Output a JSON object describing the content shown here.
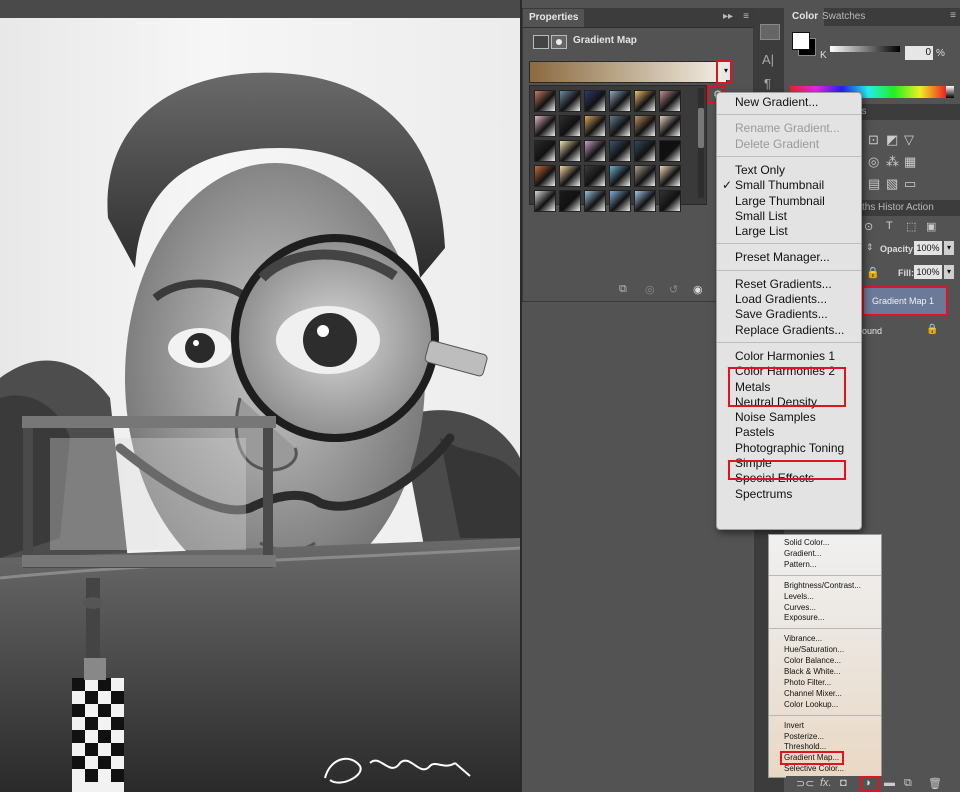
{
  "properties_panel": {
    "tab_label": "Properties",
    "adjustment_title": "Gradient Map"
  },
  "gradient_menu": {
    "groups": [
      [
        {
          "label": "New Gradient...",
          "enabled": true
        }
      ],
      [
        {
          "label": "Rename Gradient...",
          "enabled": false
        },
        {
          "label": "Delete Gradient",
          "enabled": false
        }
      ],
      [
        {
          "label": "Text Only",
          "enabled": true
        },
        {
          "label": "Small Thumbnail",
          "enabled": true,
          "checked": true
        },
        {
          "label": "Large Thumbnail",
          "enabled": true
        },
        {
          "label": "Small List",
          "enabled": true
        },
        {
          "label": "Large List",
          "enabled": true
        }
      ],
      [
        {
          "label": "Preset Manager...",
          "enabled": true
        }
      ],
      [
        {
          "label": "Reset Gradients...",
          "enabled": true
        },
        {
          "label": "Load Gradients...",
          "enabled": true
        },
        {
          "label": "Save Gradients...",
          "enabled": true
        },
        {
          "label": "Replace Gradients...",
          "enabled": true
        }
      ],
      [
        {
          "label": "Color Harmonies 1",
          "enabled": true,
          "highlighted": true
        },
        {
          "label": "Color Harmonies 2",
          "enabled": true,
          "highlighted": true
        },
        {
          "label": "Metals",
          "enabled": true
        },
        {
          "label": "Neutral Density",
          "enabled": true
        },
        {
          "label": "Noise Samples",
          "enabled": true
        },
        {
          "label": "Pastels",
          "enabled": true
        },
        {
          "label": "Photographic Toning",
          "enabled": true,
          "highlighted": true
        },
        {
          "label": "Simple",
          "enabled": true
        },
        {
          "label": "Special Effects",
          "enabled": true
        },
        {
          "label": "Spectrums",
          "enabled": true
        }
      ]
    ]
  },
  "color_panel": {
    "tabs": [
      "Color",
      "Swatches"
    ],
    "channel_label": "K",
    "value": "0",
    "unit": "%"
  },
  "layers_panel": {
    "tabs_partial": [
      "ths",
      "Histor",
      "Action"
    ],
    "opacity_label": "Opacity:",
    "opacity_value": "100%",
    "fill_label": "Fill:",
    "fill_value": "100%",
    "layers": [
      {
        "name": "Gradient Map 1",
        "selected": true
      },
      {
        "name": "ound",
        "selected": false,
        "locked": true
      }
    ]
  },
  "adjustment_menu": {
    "groups": [
      [
        "Solid Color...",
        "Gradient...",
        "Pattern..."
      ],
      [
        "Brightness/Contrast...",
        "Levels...",
        "Curves...",
        "Exposure..."
      ],
      [
        "Vibrance...",
        "Hue/Saturation...",
        "Color Balance...",
        "Black & White...",
        "Photo Filter...",
        "Channel Mixer...",
        "Color Lookup..."
      ],
      [
        "Invert",
        "Posterize...",
        "Threshold...",
        "Gradient Map...",
        "Selective Color..."
      ]
    ],
    "highlighted": "Gradient Map..."
  },
  "bottom_bar": {
    "fx_label": "fx."
  },
  "colors": {
    "gradient_bar_start": "#8a6a3e",
    "gradient_bar_end": "#f4efe6",
    "highlight": "#e0141e",
    "selected_layer": "#6b7a99"
  },
  "swatches": [
    [
      "#c87a64",
      "#6f8aa0",
      "#2d3a6b",
      "#8fa8c4",
      "#f0c070",
      "#c49090"
    ],
    [
      "#e6b7c8",
      "#2e2e2e",
      "#d9a85f",
      "#5f7f8f",
      "#b99365",
      "#e4d2b9"
    ],
    [
      "#2a2a2a",
      "#f0e0b0",
      "#c8a0c8",
      "#3a5470",
      "#2e4a5e",
      "#0f0f0f"
    ],
    [
      "#c86a3a",
      "#f7d7a0",
      "#3c3c3c",
      "#6fb0d0",
      "#b0a090",
      "#f0d8b8"
    ],
    [
      "#d8d8d8",
      "#1a1a1a",
      "#9cc0e0",
      "#80b0d8",
      "#a0c8e8",
      "#333333"
    ]
  ]
}
